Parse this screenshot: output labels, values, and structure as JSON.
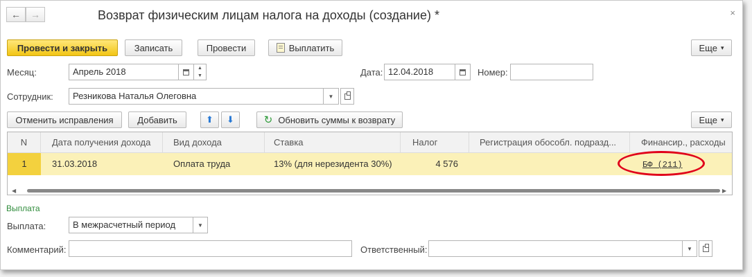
{
  "window": {
    "title": "Возврат физическим лицам налога на доходы (создание) *",
    "back_icon": "←",
    "forward_icon": "→",
    "close_icon": "×"
  },
  "toolbar": {
    "post_close": "Провести и закрыть",
    "save": "Записать",
    "post": "Провести",
    "pay": "Выплатить",
    "more": "Еще",
    "more_arrow": "▾"
  },
  "form": {
    "month_label": "Месяц:",
    "month_value": "Апрель 2018",
    "date_label": "Дата:",
    "date_value": "12.04.2018",
    "number_label": "Номер:",
    "number_value": "",
    "employee_label": "Сотрудник:",
    "employee_value": "Резникова Наталья Олеговна"
  },
  "table_toolbar": {
    "cancel_corrections": "Отменить исправления",
    "add": "Добавить",
    "refresh": "Обновить суммы к возврату",
    "more": "Еще"
  },
  "table": {
    "columns": [
      "N",
      "Дата получения дохода",
      "Вид дохода",
      "Ставка",
      "Налог",
      "Регистрация обособл. подразд...",
      "Финансир., расходы"
    ],
    "rows": [
      {
        "n": "1",
        "date": "31.03.2018",
        "type": "Оплата труда",
        "rate": "13% (для нерезидента 30%)",
        "tax": "4 576",
        "registration": "",
        "financing": "БФ (211)"
      }
    ]
  },
  "payment": {
    "section_title": "Выплата",
    "payment_label": "Выплата:",
    "payment_value": "В межрасчетный период",
    "comment_label": "Комментарий:",
    "comment_value": "",
    "responsible_label": "Ответственный:",
    "responsible_value": ""
  },
  "colors": {
    "primary_button": "#f2c515",
    "selected_row": "#fbf1b8",
    "section_title": "#2e8b3a",
    "annotation_circle": "#e0001a"
  }
}
